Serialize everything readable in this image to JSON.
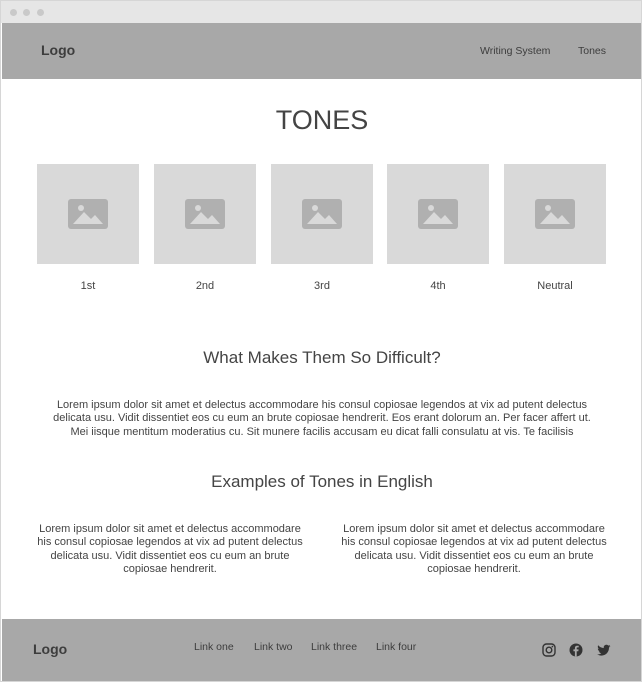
{
  "header": {
    "logo": "Logo",
    "nav": [
      "Writing System",
      "Tones"
    ]
  },
  "title": "TONES",
  "tones": [
    {
      "label": "1st",
      "icon": "image-placeholder-icon"
    },
    {
      "label": "2nd",
      "icon": "image-placeholder-icon"
    },
    {
      "label": "3rd",
      "icon": "image-placeholder-icon"
    },
    {
      "label": "4th",
      "icon": "image-placeholder-icon"
    },
    {
      "label": "Neutral",
      "icon": "image-placeholder-icon"
    }
  ],
  "difficulty": {
    "heading": "What Makes Them So Difficult?",
    "lines": [
      "Lorem ipsum dolor sit amet et delectus accommodare his consul copiosae legendos at vix ad putent delectus",
      "delicata usu. Vidit dissentiet eos cu eum an brute copiosae hendrerit. Eos erant dolorum an. Per facer affert ut.",
      "Mei iisque mentitum moderatius cu. Sit munere facilis accusam eu dicat falli consulatu at vis. Te facilisis"
    ]
  },
  "examples": {
    "heading": "Examples of Tones in English",
    "columns": [
      {
        "lines": [
          "Lorem ipsum dolor sit amet et delectus accommodare",
          "his consul copiosae legendos at vix ad putent delectus",
          "delicata usu. Vidit dissentiet eos cu eum an brute",
          "copiosae hendrerit."
        ]
      },
      {
        "lines": [
          "Lorem ipsum dolor sit amet et delectus accommodare",
          "his consul copiosae legendos at vix ad putent delectus",
          "delicata usu. Vidit dissentiet eos cu eum an brute",
          "copiosae hendrerit."
        ]
      }
    ]
  },
  "footer": {
    "logo": "Logo",
    "links": [
      "Link one",
      "Link two",
      "Link three",
      "Link four"
    ],
    "social": [
      "instagram-icon",
      "facebook-icon",
      "twitter-icon"
    ]
  },
  "colors": {
    "header_bg": "#a8a8a8",
    "tile_bg": "#d9d9d9",
    "text": "#444444"
  }
}
